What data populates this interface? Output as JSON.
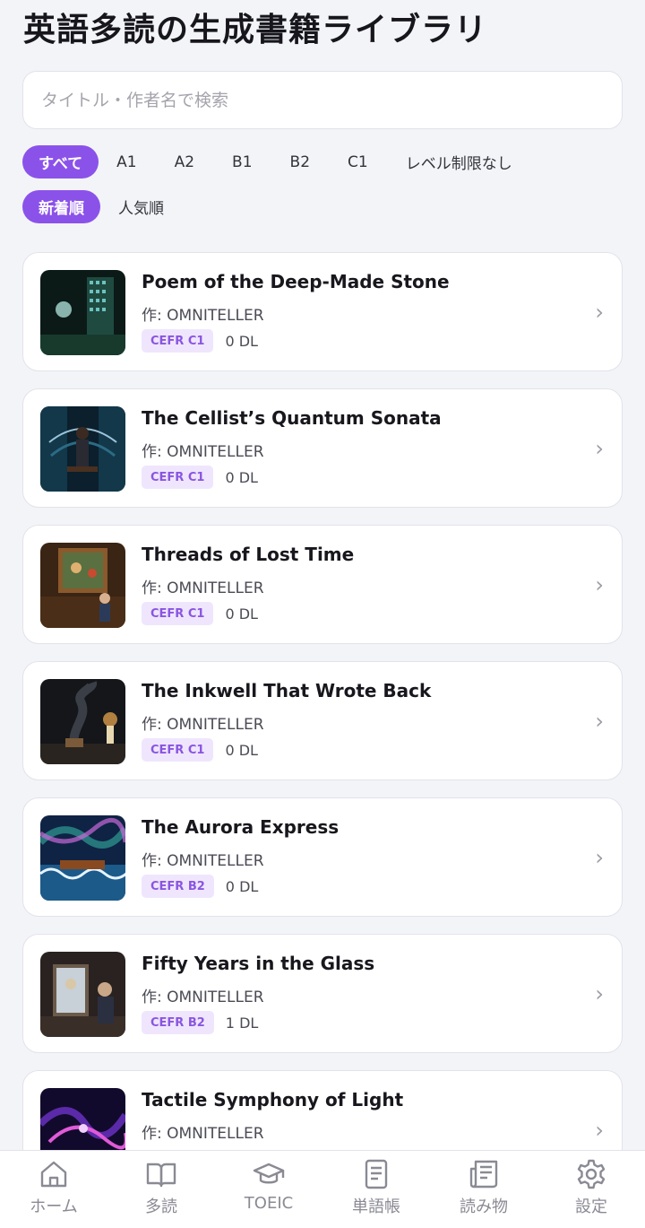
{
  "header": {
    "title": "英語多読の生成書籍ライブラリ"
  },
  "search": {
    "placeholder": "タイトル・作者名で検索",
    "value": ""
  },
  "level_filters": [
    {
      "label": "すべて",
      "selected": true
    },
    {
      "label": "A1",
      "selected": false
    },
    {
      "label": "A2",
      "selected": false
    },
    {
      "label": "B1",
      "selected": false
    },
    {
      "label": "B2",
      "selected": false
    },
    {
      "label": "C1",
      "selected": false
    },
    {
      "label": "レベル制限なし",
      "selected": false
    }
  ],
  "sort_options": [
    {
      "label": "新着順",
      "selected": true
    },
    {
      "label": "人気順",
      "selected": false
    }
  ],
  "books": [
    {
      "title": "Poem of the Deep-Made Stone",
      "author": "作: OMNITELLER",
      "level": "CEFR C1",
      "downloads": "0 DL",
      "cover_colors": [
        "#0c1a17",
        "#1f4a40",
        "#7fe0e0"
      ]
    },
    {
      "title": "The Cellist’s Quantum Sonata",
      "author": "作: OMNITELLER",
      "level": "CEFR C1",
      "downloads": "0 DL",
      "cover_colors": [
        "#0b1f2c",
        "#2c6b86",
        "#bfe9ff"
      ]
    },
    {
      "title": "Threads of Lost Time",
      "author": "作: OMNITELLER",
      "level": "CEFR C1",
      "downloads": "0 DL",
      "cover_colors": [
        "#3a2414",
        "#8a5a2c",
        "#e0b070"
      ]
    },
    {
      "title": "The Inkwell That Wrote Back",
      "author": "作: OMNITELLER",
      "level": "CEFR C1",
      "downloads": "0 DL",
      "cover_colors": [
        "#14161a",
        "#3a3e46",
        "#d89a4a"
      ]
    },
    {
      "title": "The Aurora Express",
      "author": "作: OMNITELLER",
      "level": "CEFR B2",
      "downloads": "0 DL",
      "cover_colors": [
        "#0f2344",
        "#2a8c8a",
        "#c86ad8"
      ]
    },
    {
      "title": "Fifty Years in the Glass",
      "author": "作: OMNITELLER",
      "level": "CEFR B2",
      "downloads": "1 DL",
      "cover_colors": [
        "#2a2220",
        "#6a5a4a",
        "#d8c8a8"
      ]
    },
    {
      "title": "Tactile Symphony of Light",
      "author": "作: OMNITELLER",
      "level": "",
      "downloads": "",
      "cover_colors": [
        "#120a2c",
        "#5a2aa8",
        "#e05ad8"
      ]
    }
  ],
  "bottom_nav": [
    {
      "label": "ホーム",
      "icon": "home-icon"
    },
    {
      "label": "多読",
      "icon": "open-book-icon"
    },
    {
      "label": "TOEIC",
      "icon": "graduation-cap-icon"
    },
    {
      "label": "単語帳",
      "icon": "notebook-icon"
    },
    {
      "label": "読み物",
      "icon": "newspaper-icon"
    },
    {
      "label": "設定",
      "icon": "gear-icon"
    }
  ],
  "colors": {
    "accent": "#8b52ea",
    "badge_bg": "#efe6fd",
    "badge_text": "#8a55e0",
    "background": "#f3f4f8"
  }
}
